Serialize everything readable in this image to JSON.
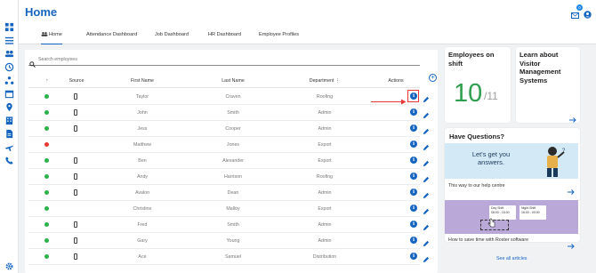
{
  "page": {
    "title": "Home"
  },
  "topbar": {
    "notification_count": "0"
  },
  "tabs": [
    {
      "label": "Home"
    },
    {
      "label": "Attendance Dashboard"
    },
    {
      "label": "Job Dashboard"
    },
    {
      "label": "HR Dashboard"
    },
    {
      "label": "Employee Profiles"
    }
  ],
  "search": {
    "placeholder": "Search employees"
  },
  "table": {
    "headers": {
      "sort": "↑",
      "source": "Source",
      "first_name": "First Name",
      "last_name": "Last Name",
      "department": "Department",
      "actions": "Actions"
    },
    "rows": [
      {
        "status": "green",
        "first": "Taylor",
        "last": "Craven",
        "dept": "Roofing",
        "has_phone": true
      },
      {
        "status": "green",
        "first": "John",
        "last": "Smith",
        "dept": "Admin",
        "has_phone": true
      },
      {
        "status": "green",
        "first": "Jess",
        "last": "Cooper",
        "dept": "Admin",
        "has_phone": true
      },
      {
        "status": "red",
        "first": "Matthew",
        "last": "Jones",
        "dept": "Export",
        "has_phone": false
      },
      {
        "status": "green",
        "first": "Ben",
        "last": "Alexander",
        "dept": "Export",
        "has_phone": true
      },
      {
        "status": "green",
        "first": "Andy",
        "last": "Harrison",
        "dept": "Roofing",
        "has_phone": true
      },
      {
        "status": "green",
        "first": "Avalon",
        "last": "Dean",
        "dept": "Admin",
        "has_phone": true
      },
      {
        "status": "green",
        "first": "Christine",
        "last": "Malloy",
        "dept": "Export",
        "has_phone": false
      },
      {
        "status": "green",
        "first": "Fred",
        "last": "Smith",
        "dept": "Admin",
        "has_phone": true
      },
      {
        "status": "green",
        "first": "Gary",
        "last": "Young",
        "dept": "Admin",
        "has_phone": true
      },
      {
        "status": "green",
        "first": "Ace",
        "last": "Samuel",
        "dept": "Distribution",
        "has_phone": true
      }
    ]
  },
  "colors": {
    "accent": "#1565c0",
    "green": "#2e9e4f",
    "status_green": "#2bb34a",
    "status_red": "#e53935"
  },
  "cards": {
    "shift": {
      "title": "Employees on shift",
      "count": "10",
      "total": "/11"
    },
    "visitor": {
      "title": "Learn about Visitor Management Systems"
    },
    "questions": {
      "title": "Have Questions?",
      "promo_text": "Let's get you answers.",
      "caption": "This way to our help centre"
    },
    "roster": {
      "day_shift": "Day Shift",
      "day_time": "08:00 - 16:00",
      "night_shift": "Night Shift",
      "night_time": "16:00 - 00:00",
      "caption": "How to save time with Roster software"
    },
    "see_all": "See all articles"
  }
}
